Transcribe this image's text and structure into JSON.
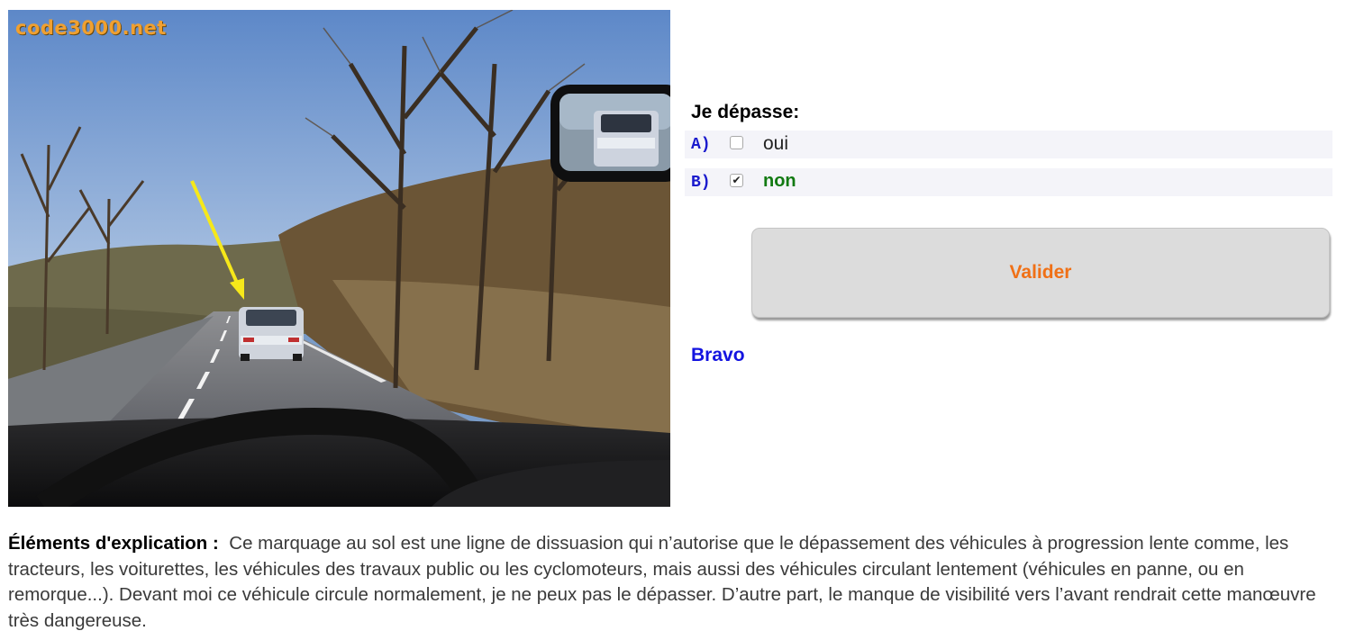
{
  "scene_image": {
    "watermark": "code3000.net",
    "icons": [
      "road-scene-photo",
      "yellow-arrow-icon",
      "rearview-mirror-icon",
      "steering-wheel-icon"
    ]
  },
  "question": {
    "prompt": "Je dépasse:",
    "answers": [
      {
        "letter": "A)",
        "label": "oui",
        "checked": false
      },
      {
        "letter": "B)",
        "label": "non",
        "checked": true
      }
    ]
  },
  "validate_button": {
    "label": "Valider"
  },
  "feedback": {
    "text": "Bravo"
  },
  "explanation": {
    "heading": "Éléments d'explication :",
    "body": "Ce marquage au sol est une ligne de dissuasion qui n’autorise que le dépassement des véhicules à progression lente comme, les tracteurs, les voiturettes, les véhicules des travaux public ou les cyclomoteurs, mais aussi des véhicules circulant lentement (véhicules en panne, ou en remorque...). Devant moi ce véhicule circule normalement, je ne peux pas le dépasser. D’autre part, le manque de visibilité vers l’avant rendrait cette manœuvre très dangereuse."
  },
  "colors": {
    "letter": "#1a1acd",
    "correct_answer": "#127a12",
    "button_text": "#f07016",
    "feedback": "#1414e0",
    "row_background": "#f4f4f9"
  }
}
